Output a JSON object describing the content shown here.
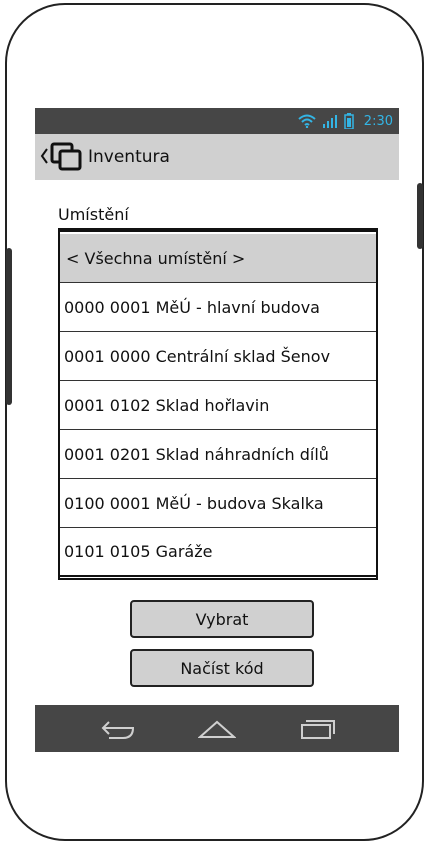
{
  "status_bar": {
    "time": "2:30",
    "accent_color": "#33b5e5",
    "icons": [
      "wifi-icon",
      "signal-icon",
      "battery-icon"
    ]
  },
  "action_bar": {
    "title": "Inventura",
    "icons": [
      "back-chevron-icon",
      "app-windows-icon"
    ]
  },
  "form": {
    "label": "Umístění",
    "items": [
      {
        "label": "< Všechna umístění >",
        "selected": true
      },
      {
        "label": "0000 0001 MěÚ - hlavní budova",
        "selected": false
      },
      {
        "label": "0001 0000 Centrální sklad Šenov",
        "selected": false
      },
      {
        "label": "0001 0102 Sklad hořlavin",
        "selected": false
      },
      {
        "label": "0001 0201 Sklad náhradních dílů",
        "selected": false
      },
      {
        "label": "0100 0001 MěÚ - budova Skalka",
        "selected": false
      },
      {
        "label": "0101 0105 Garáže",
        "selected": false
      }
    ]
  },
  "buttons": {
    "select_label": "Vybrat",
    "scan_label": "Načíst kód"
  },
  "nav_bar": {
    "icons": [
      "back-icon",
      "home-icon",
      "recents-icon"
    ]
  }
}
